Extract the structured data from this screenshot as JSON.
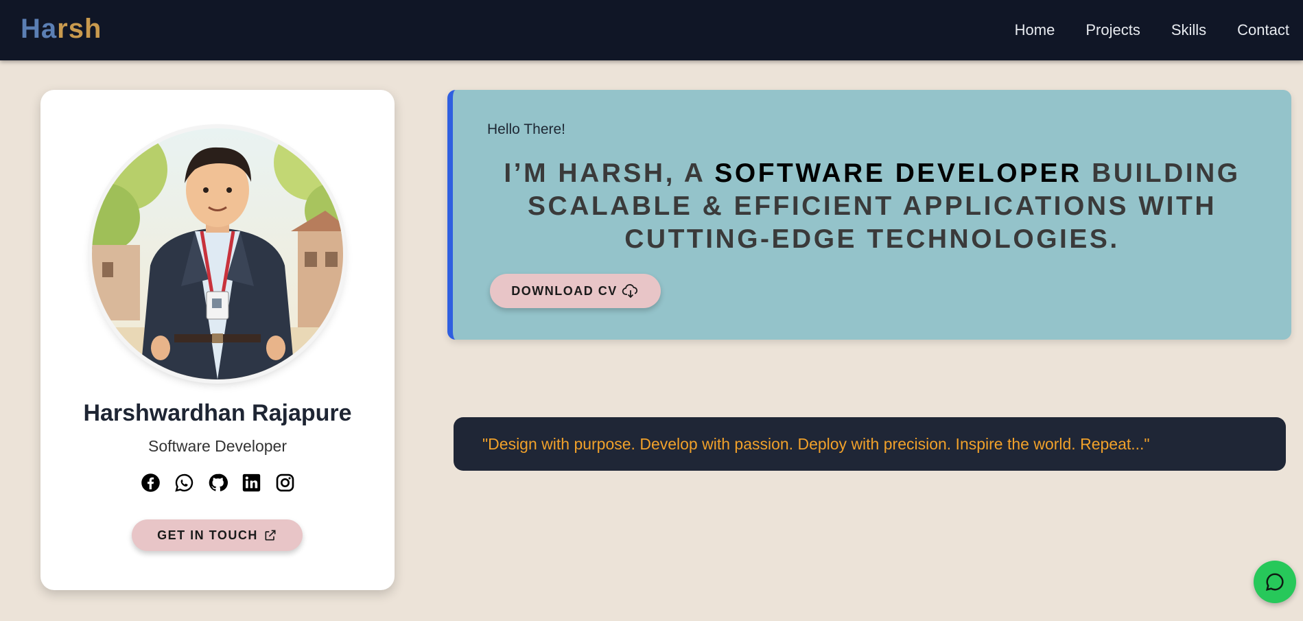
{
  "nav": {
    "logo_part1": "Ha",
    "logo_part2": "rsh",
    "links": [
      "Home",
      "Projects",
      "Skills",
      "Contact"
    ]
  },
  "profile": {
    "name": "Harshwardhan Rajapure",
    "role": "Software Developer",
    "socials": [
      "facebook-icon",
      "whatsapp-icon",
      "github-icon",
      "linkedin-icon",
      "instagram-icon"
    ],
    "cta_label": "GET IN TOUCH"
  },
  "hero": {
    "greeting": "Hello There!",
    "headline_pre": "I’M HARSH, A ",
    "headline_highlight": "SOFTWARE DEVELOPER",
    "headline_post": " BUILDING SCALABLE & EFFICIENT APPLICATIONS WITH CUTTING-EDGE TECHNOLOGIES.",
    "cv_label": "DOWNLOAD CV"
  },
  "quote": {
    "text": "\"Design with purpose. Develop with passion. Deploy with precision. Inspire the world. Repeat...\""
  },
  "colors": {
    "nav_bg": "#101626",
    "page_bg": "#ece3d8",
    "hero_bg": "#94c3ca",
    "accent_border": "#2f5fe0",
    "button_bg": "#e8c5c7",
    "quote_bg": "#1f2636",
    "quote_text": "#f1a12a",
    "chat_fab": "#27c85a"
  }
}
